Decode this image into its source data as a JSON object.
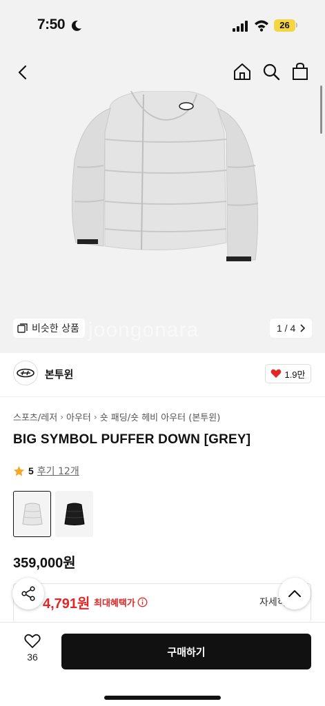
{
  "status_bar": {
    "time": "7:50",
    "battery": "26"
  },
  "gallery": {
    "similar_label": "비슷한 상품",
    "page_counter": "1 / 4",
    "watermark": "joongonara"
  },
  "brand": {
    "name": "본투윈",
    "likes": "1.9만"
  },
  "breadcrumb": [
    "스포츠/레저",
    "아우터",
    "숏 패딩/숏 헤비 아우터 (본투윈)"
  ],
  "product": {
    "title": "BIG SYMBOL PUFFER DOWN [GREY]",
    "rating": "5",
    "review_link": "후기 12개",
    "price": "359,000원"
  },
  "swatches": [
    {
      "name": "grey",
      "color": "#e6e6e6",
      "selected": true
    },
    {
      "name": "black",
      "color": "#1c1c1c",
      "selected": false
    }
  ],
  "benefit": {
    "price": "4,791원",
    "label": "최대혜택가",
    "detail_label": "자세히"
  },
  "bottom_bar": {
    "wish_count": "36",
    "buy_label": "구매하기"
  },
  "colors": {
    "accent_red": "#e32525",
    "rating_star": "#f5a623",
    "buy_button": "#111111"
  },
  "icons": [
    "moon-icon",
    "signal-icon",
    "wifi-icon",
    "back-icon",
    "home-icon",
    "search-icon",
    "bag-icon",
    "similar-icon",
    "chevron-right-icon",
    "heart-icon",
    "star-icon",
    "info-icon",
    "share-icon",
    "chevron-up-icon"
  ]
}
